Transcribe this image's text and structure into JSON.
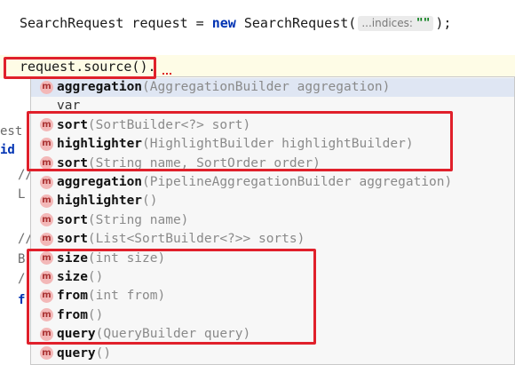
{
  "colors": {
    "keyword": "#0033b3",
    "string_hint": "#067d17",
    "highlight_border": "#e0202b",
    "method_badge_bg": "#f3b8b8",
    "method_badge_fg": "#aa3333",
    "popup_bg": "#f7f7f7",
    "selected_bg": "#dfe6f3"
  },
  "code": {
    "line1": {
      "prefix": "SearchRequest request = ",
      "keyword": "new",
      "call": " SearchRequest(",
      "hint_label": "...indices:",
      "hint_value": "\"\"",
      "suffix": ");"
    },
    "line2": {
      "text": "request.source().",
      "squiggle": "_"
    }
  },
  "gutter_fragments": [
    "est",
    "id",
    "//",
    "L",
    "//",
    "B",
    "/",
    "f"
  ],
  "completion": {
    "badge_letter": "m",
    "items": [
      {
        "name": "aggregation",
        "sig": "(AggregationBuilder aggregation)",
        "icon": "method-icon",
        "selected": true
      },
      {
        "name": "var",
        "sig": "",
        "icon": "",
        "selected": false
      },
      {
        "name": "sort",
        "sig": "(SortBuilder<?> sort)",
        "icon": "method-icon",
        "selected": false
      },
      {
        "name": "highlighter",
        "sig": "(HighlightBuilder highlightBuilder)",
        "icon": "method-icon",
        "selected": false
      },
      {
        "name": "sort",
        "sig": "(String name, SortOrder order)",
        "icon": "method-icon",
        "selected": false
      },
      {
        "name": "aggregation",
        "sig": "(PipelineAggregationBuilder aggregation)",
        "icon": "method-icon",
        "selected": false
      },
      {
        "name": "highlighter",
        "sig": "()",
        "icon": "method-icon",
        "selected": false
      },
      {
        "name": "sort",
        "sig": "(String name)",
        "icon": "method-icon",
        "selected": false
      },
      {
        "name": "sort",
        "sig": "(List<SortBuilder<?>> sorts)",
        "icon": "method-icon",
        "selected": false
      },
      {
        "name": "size",
        "sig": "(int size)",
        "icon": "method-icon",
        "selected": false
      },
      {
        "name": "size",
        "sig": "()",
        "icon": "method-icon",
        "selected": false
      },
      {
        "name": "from",
        "sig": "(int from)",
        "icon": "method-icon",
        "selected": false
      },
      {
        "name": "from",
        "sig": "()",
        "icon": "method-icon",
        "selected": false
      },
      {
        "name": "query",
        "sig": "(QueryBuilder query)",
        "icon": "method-icon",
        "selected": false
      },
      {
        "name": "query",
        "sig": "()",
        "icon": "method-icon",
        "selected": false
      }
    ]
  }
}
